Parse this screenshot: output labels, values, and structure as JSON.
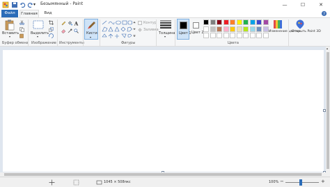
{
  "window": {
    "title": "Безымянный - Paint",
    "controls": {
      "minimize": "—",
      "maximize": "☐",
      "close": "✕"
    }
  },
  "tabs": {
    "file": "Файл",
    "home": "Главная",
    "view": "Вид"
  },
  "ribbon": {
    "clipboard": {
      "paste": "Вставить",
      "group": "Буфер обмена"
    },
    "image": {
      "select": "Выделить",
      "group": "Изображение"
    },
    "tools": {
      "group": "Инструменты"
    },
    "brushes": {
      "label": "Кисти"
    },
    "shapes": {
      "outline": "Контур",
      "fill": "Заливка",
      "group": "Фигуры"
    },
    "size": {
      "label": "Толщина"
    },
    "colors": {
      "color1": "Цвет 1",
      "color2": "Цвет 2",
      "edit": "Изменение цветов",
      "group": "Цвета",
      "color1_value": "#000000",
      "color2_value": "#ffffff",
      "palette_row1": [
        "#000000",
        "#7f7f7f",
        "#880015",
        "#ed1c24",
        "#ff7f27",
        "#fff200",
        "#22b14c",
        "#00a2e8",
        "#3f48cc",
        "#a349a4"
      ],
      "palette_row2": [
        "#ffffff",
        "#c3c3c3",
        "#b97a57",
        "#ffaec9",
        "#ffc90e",
        "#efe4b0",
        "#b5e61d",
        "#99d9ea",
        "#7092be",
        "#c8bfe7"
      ],
      "palette_row3": [
        "#ffffff",
        "#ffffff",
        "#ffffff",
        "#ffffff",
        "#ffffff",
        "#ffffff",
        "#ffffff",
        "#ffffff",
        "#ffffff",
        "#ffffff"
      ]
    },
    "paint3d": {
      "label": "Открыть Paint 3D"
    }
  },
  "status": {
    "dimensions": "1045 × 508пкс",
    "zoom": "100%"
  }
}
